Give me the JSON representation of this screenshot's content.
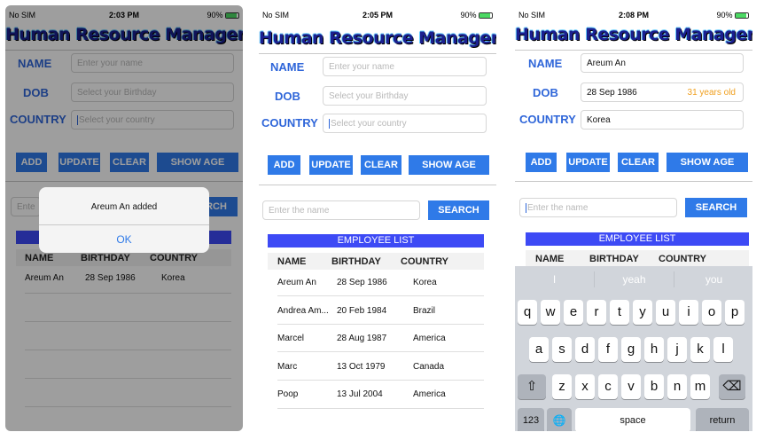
{
  "status": {
    "carrier": "No SIM",
    "times": [
      "2:03 PM",
      "2:05 PM",
      "2:08 PM"
    ],
    "battery": "90%"
  },
  "app_title": "Human Resource Management",
  "form": {
    "name_label": "NAME",
    "dob_label": "DOB",
    "country_label": "COUNTRY",
    "name_placeholder": "Enter your name",
    "dob_placeholder": "Select your Birthday",
    "country_placeholder": "Select your country",
    "filled": {
      "name": "Areum An",
      "dob": "28 Sep 1986",
      "age": "31 years old",
      "country": "Korea"
    }
  },
  "buttons": {
    "add": "ADD",
    "update": "UPDATE",
    "clear": "CLEAR",
    "show_age": "SHOW AGE",
    "search": "SEARCH",
    "search_partial": "RCH"
  },
  "search": {
    "placeholder": "Enter the name",
    "placeholder_partial": "Ente"
  },
  "list": {
    "header": "EMPLOYEE LIST",
    "columns": [
      "NAME",
      "BIRTHDAY",
      "COUNTRY"
    ],
    "rows_screen1": [
      {
        "name": "Areum An",
        "birthday": "28 Sep 1986",
        "country": "Korea"
      }
    ],
    "rows_screen2": [
      {
        "name": "Areum An",
        "birthday": "28 Sep 1986",
        "country": "Korea"
      },
      {
        "name": "Andrea Am...",
        "birthday": "20 Feb 1984",
        "country": "Brazil"
      },
      {
        "name": "Marcel",
        "birthday": "28 Aug 1987",
        "country": "America"
      },
      {
        "name": "Marc",
        "birthday": "13 Oct 1979",
        "country": "Canada"
      },
      {
        "name": "Poop",
        "birthday": "13 Jul 2004",
        "country": "America"
      }
    ]
  },
  "alert": {
    "message": "Areum An added",
    "ok": "OK"
  },
  "keyboard": {
    "suggestions": [
      "I",
      "yeah",
      "you"
    ],
    "row1": [
      "q",
      "w",
      "e",
      "r",
      "t",
      "y",
      "u",
      "i",
      "o",
      "p"
    ],
    "row2": [
      "a",
      "s",
      "d",
      "f",
      "g",
      "h",
      "j",
      "k",
      "l"
    ],
    "row3": [
      "z",
      "x",
      "c",
      "v",
      "b",
      "n",
      "m"
    ],
    "shift": "⇧",
    "backspace": "⌫",
    "numbers": "123",
    "globe": "🌐",
    "space": "space",
    "return": "return"
  }
}
